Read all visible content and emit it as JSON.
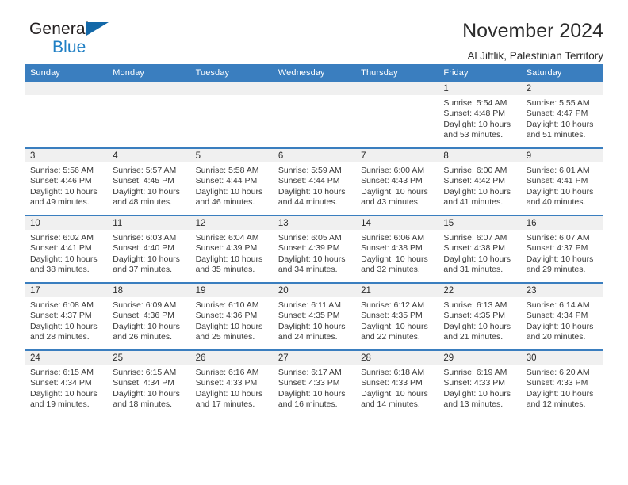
{
  "brand": {
    "name_top": "General",
    "name_bottom": "Blue",
    "triangle_color": "#1368a8",
    "blue_color": "#1f7fc4"
  },
  "header": {
    "title": "November 2024",
    "subtitle": "Al Jiftlik, Palestinian Territory"
  },
  "theme": {
    "header_blue": "#3a7ebf",
    "daynum_strip": "#f0f0f0",
    "text": "#3a3a3a"
  },
  "weekdays": [
    "Sunday",
    "Monday",
    "Tuesday",
    "Wednesday",
    "Thursday",
    "Friday",
    "Saturday"
  ],
  "weeks": [
    [
      {
        "day": "",
        "empty": true
      },
      {
        "day": "",
        "empty": true
      },
      {
        "day": "",
        "empty": true
      },
      {
        "day": "",
        "empty": true
      },
      {
        "day": "",
        "empty": true
      },
      {
        "day": "1",
        "sunrise": "Sunrise: 5:54 AM",
        "sunset": "Sunset: 4:48 PM",
        "daylight": "Daylight: 10 hours and 53 minutes."
      },
      {
        "day": "2",
        "sunrise": "Sunrise: 5:55 AM",
        "sunset": "Sunset: 4:47 PM",
        "daylight": "Daylight: 10 hours and 51 minutes."
      }
    ],
    [
      {
        "day": "3",
        "sunrise": "Sunrise: 5:56 AM",
        "sunset": "Sunset: 4:46 PM",
        "daylight": "Daylight: 10 hours and 49 minutes."
      },
      {
        "day": "4",
        "sunrise": "Sunrise: 5:57 AM",
        "sunset": "Sunset: 4:45 PM",
        "daylight": "Daylight: 10 hours and 48 minutes."
      },
      {
        "day": "5",
        "sunrise": "Sunrise: 5:58 AM",
        "sunset": "Sunset: 4:44 PM",
        "daylight": "Daylight: 10 hours and 46 minutes."
      },
      {
        "day": "6",
        "sunrise": "Sunrise: 5:59 AM",
        "sunset": "Sunset: 4:44 PM",
        "daylight": "Daylight: 10 hours and 44 minutes."
      },
      {
        "day": "7",
        "sunrise": "Sunrise: 6:00 AM",
        "sunset": "Sunset: 4:43 PM",
        "daylight": "Daylight: 10 hours and 43 minutes."
      },
      {
        "day": "8",
        "sunrise": "Sunrise: 6:00 AM",
        "sunset": "Sunset: 4:42 PM",
        "daylight": "Daylight: 10 hours and 41 minutes."
      },
      {
        "day": "9",
        "sunrise": "Sunrise: 6:01 AM",
        "sunset": "Sunset: 4:41 PM",
        "daylight": "Daylight: 10 hours and 40 minutes."
      }
    ],
    [
      {
        "day": "10",
        "sunrise": "Sunrise: 6:02 AM",
        "sunset": "Sunset: 4:41 PM",
        "daylight": "Daylight: 10 hours and 38 minutes."
      },
      {
        "day": "11",
        "sunrise": "Sunrise: 6:03 AM",
        "sunset": "Sunset: 4:40 PM",
        "daylight": "Daylight: 10 hours and 37 minutes."
      },
      {
        "day": "12",
        "sunrise": "Sunrise: 6:04 AM",
        "sunset": "Sunset: 4:39 PM",
        "daylight": "Daylight: 10 hours and 35 minutes."
      },
      {
        "day": "13",
        "sunrise": "Sunrise: 6:05 AM",
        "sunset": "Sunset: 4:39 PM",
        "daylight": "Daylight: 10 hours and 34 minutes."
      },
      {
        "day": "14",
        "sunrise": "Sunrise: 6:06 AM",
        "sunset": "Sunset: 4:38 PM",
        "daylight": "Daylight: 10 hours and 32 minutes."
      },
      {
        "day": "15",
        "sunrise": "Sunrise: 6:07 AM",
        "sunset": "Sunset: 4:38 PM",
        "daylight": "Daylight: 10 hours and 31 minutes."
      },
      {
        "day": "16",
        "sunrise": "Sunrise: 6:07 AM",
        "sunset": "Sunset: 4:37 PM",
        "daylight": "Daylight: 10 hours and 29 minutes."
      }
    ],
    [
      {
        "day": "17",
        "sunrise": "Sunrise: 6:08 AM",
        "sunset": "Sunset: 4:37 PM",
        "daylight": "Daylight: 10 hours and 28 minutes."
      },
      {
        "day": "18",
        "sunrise": "Sunrise: 6:09 AM",
        "sunset": "Sunset: 4:36 PM",
        "daylight": "Daylight: 10 hours and 26 minutes."
      },
      {
        "day": "19",
        "sunrise": "Sunrise: 6:10 AM",
        "sunset": "Sunset: 4:36 PM",
        "daylight": "Daylight: 10 hours and 25 minutes."
      },
      {
        "day": "20",
        "sunrise": "Sunrise: 6:11 AM",
        "sunset": "Sunset: 4:35 PM",
        "daylight": "Daylight: 10 hours and 24 minutes."
      },
      {
        "day": "21",
        "sunrise": "Sunrise: 6:12 AM",
        "sunset": "Sunset: 4:35 PM",
        "daylight": "Daylight: 10 hours and 22 minutes."
      },
      {
        "day": "22",
        "sunrise": "Sunrise: 6:13 AM",
        "sunset": "Sunset: 4:35 PM",
        "daylight": "Daylight: 10 hours and 21 minutes."
      },
      {
        "day": "23",
        "sunrise": "Sunrise: 6:14 AM",
        "sunset": "Sunset: 4:34 PM",
        "daylight": "Daylight: 10 hours and 20 minutes."
      }
    ],
    [
      {
        "day": "24",
        "sunrise": "Sunrise: 6:15 AM",
        "sunset": "Sunset: 4:34 PM",
        "daylight": "Daylight: 10 hours and 19 minutes."
      },
      {
        "day": "25",
        "sunrise": "Sunrise: 6:15 AM",
        "sunset": "Sunset: 4:34 PM",
        "daylight": "Daylight: 10 hours and 18 minutes."
      },
      {
        "day": "26",
        "sunrise": "Sunrise: 6:16 AM",
        "sunset": "Sunset: 4:33 PM",
        "daylight": "Daylight: 10 hours and 17 minutes."
      },
      {
        "day": "27",
        "sunrise": "Sunrise: 6:17 AM",
        "sunset": "Sunset: 4:33 PM",
        "daylight": "Daylight: 10 hours and 16 minutes."
      },
      {
        "day": "28",
        "sunrise": "Sunrise: 6:18 AM",
        "sunset": "Sunset: 4:33 PM",
        "daylight": "Daylight: 10 hours and 14 minutes."
      },
      {
        "day": "29",
        "sunrise": "Sunrise: 6:19 AM",
        "sunset": "Sunset: 4:33 PM",
        "daylight": "Daylight: 10 hours and 13 minutes."
      },
      {
        "day": "30",
        "sunrise": "Sunrise: 6:20 AM",
        "sunset": "Sunset: 4:33 PM",
        "daylight": "Daylight: 10 hours and 12 minutes."
      }
    ]
  ]
}
